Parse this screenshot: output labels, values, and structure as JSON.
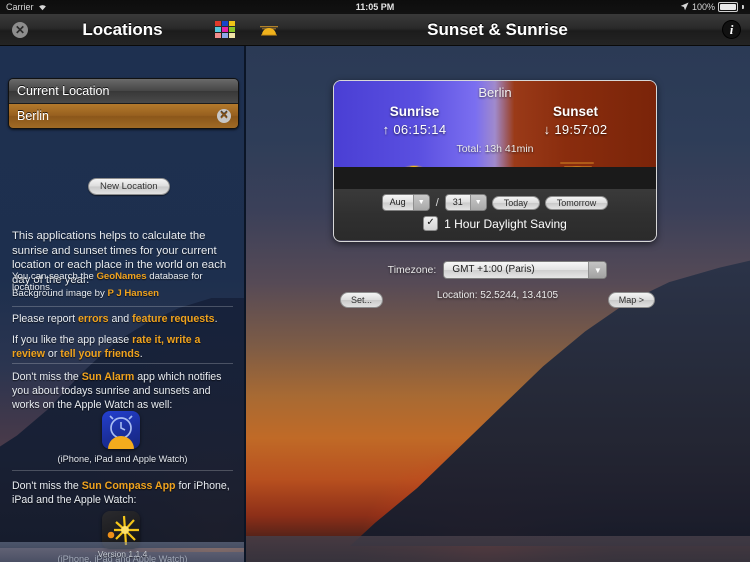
{
  "status_bar": {
    "carrier": "Carrier",
    "wifi_icon": "wifi-icon",
    "time": "11:05 PM",
    "location_arrow_icon": "location-arrow-icon",
    "battery_percent": "100%",
    "battery_icon": "battery-icon"
  },
  "left_nav": {
    "title": "Locations",
    "close_icon": "close-icon",
    "grid_icon": "color-grid-icon"
  },
  "right_nav": {
    "title": "Sunset & Sunrise",
    "sun_icon": "sun-icon",
    "info_icon": "info-icon"
  },
  "locations": {
    "rows": [
      {
        "label": "Current Location",
        "selected": false
      },
      {
        "label": "Berlin",
        "selected": true,
        "clear_icon": "clear-icon"
      }
    ],
    "new_location_button": "New Location"
  },
  "info_text": {
    "intro": "This applications helps to calculate the sunrise and sunset times for your current location or each place in the world on each day of the year.",
    "geonames_pre": "You can search the ",
    "geonames_link": "GeoNames",
    "geonames_post": " database for locations.",
    "bg_pre": "Background image by ",
    "bg_link": "P J Hansen",
    "report_pre": "Please report ",
    "report_link1": "errors",
    "report_mid": " and ",
    "report_link2": "feature requests",
    "report_post": ".",
    "rate_pre": "If you like the app please ",
    "rate_link1": "rate it, write a review",
    "rate_mid": " or ",
    "rate_link2": "tell your friends",
    "rate_post": ".",
    "alarm_pre": "Don't miss the ",
    "alarm_link": "Sun Alarm",
    "alarm_post": " app which notifies you about todays sunrise and sunsets and works on the Apple Watch as well:",
    "alarm_caption": "(iPhone, iPad and Apple Watch)",
    "compass_pre": "Don't miss the ",
    "compass_link": "Sun Compass App",
    "compass_post": " for iPhone, iPad and the Apple Watch:",
    "compass_caption": "(iPhone, iPad and Apple Watch)",
    "alarm_icon": "sun-alarm-app-icon",
    "compass_icon": "sun-compass-app-icon"
  },
  "version": "Version 1.1.4",
  "card": {
    "city": "Berlin",
    "sunrise_label": "Sunrise",
    "sunrise_arrow": "↑",
    "sunrise_time": "06:15:14",
    "sunset_label": "Sunset",
    "sunset_arrow": "↓",
    "sunset_time": "19:57:02",
    "total": "Total: 13h 41min",
    "month": "Aug",
    "day": "31",
    "separator": "/",
    "today_button": "Today",
    "tomorrow_button": "Tomorrow",
    "dst_label": "1 Hour Daylight Saving",
    "dst_checked": "✓",
    "sunrise_icon": "rising-sun-icon",
    "sunset_icon": "setting-sun-icon"
  },
  "timezone": {
    "label": "Timezone:",
    "value": "GMT +1:00 (Paris)"
  },
  "footer": {
    "set_button": "Set...",
    "location": "Location:  52.5244,  13.4105",
    "map_button": "Map >"
  },
  "colors": {
    "accent_link": "#f0a31e",
    "selected_row": "#97601f",
    "sunrise_sky": "#5a4fe0",
    "sunset_sky": "#8a2d0e",
    "sun_yellow": "#f5b310"
  },
  "grid_icon_colors": [
    "#e03a2a",
    "#1745c9",
    "#f0c517",
    "#57c9dd",
    "#e423a6",
    "#8ac427",
    "#f08c8c",
    "#8da7e8",
    "#efe3a6"
  ]
}
